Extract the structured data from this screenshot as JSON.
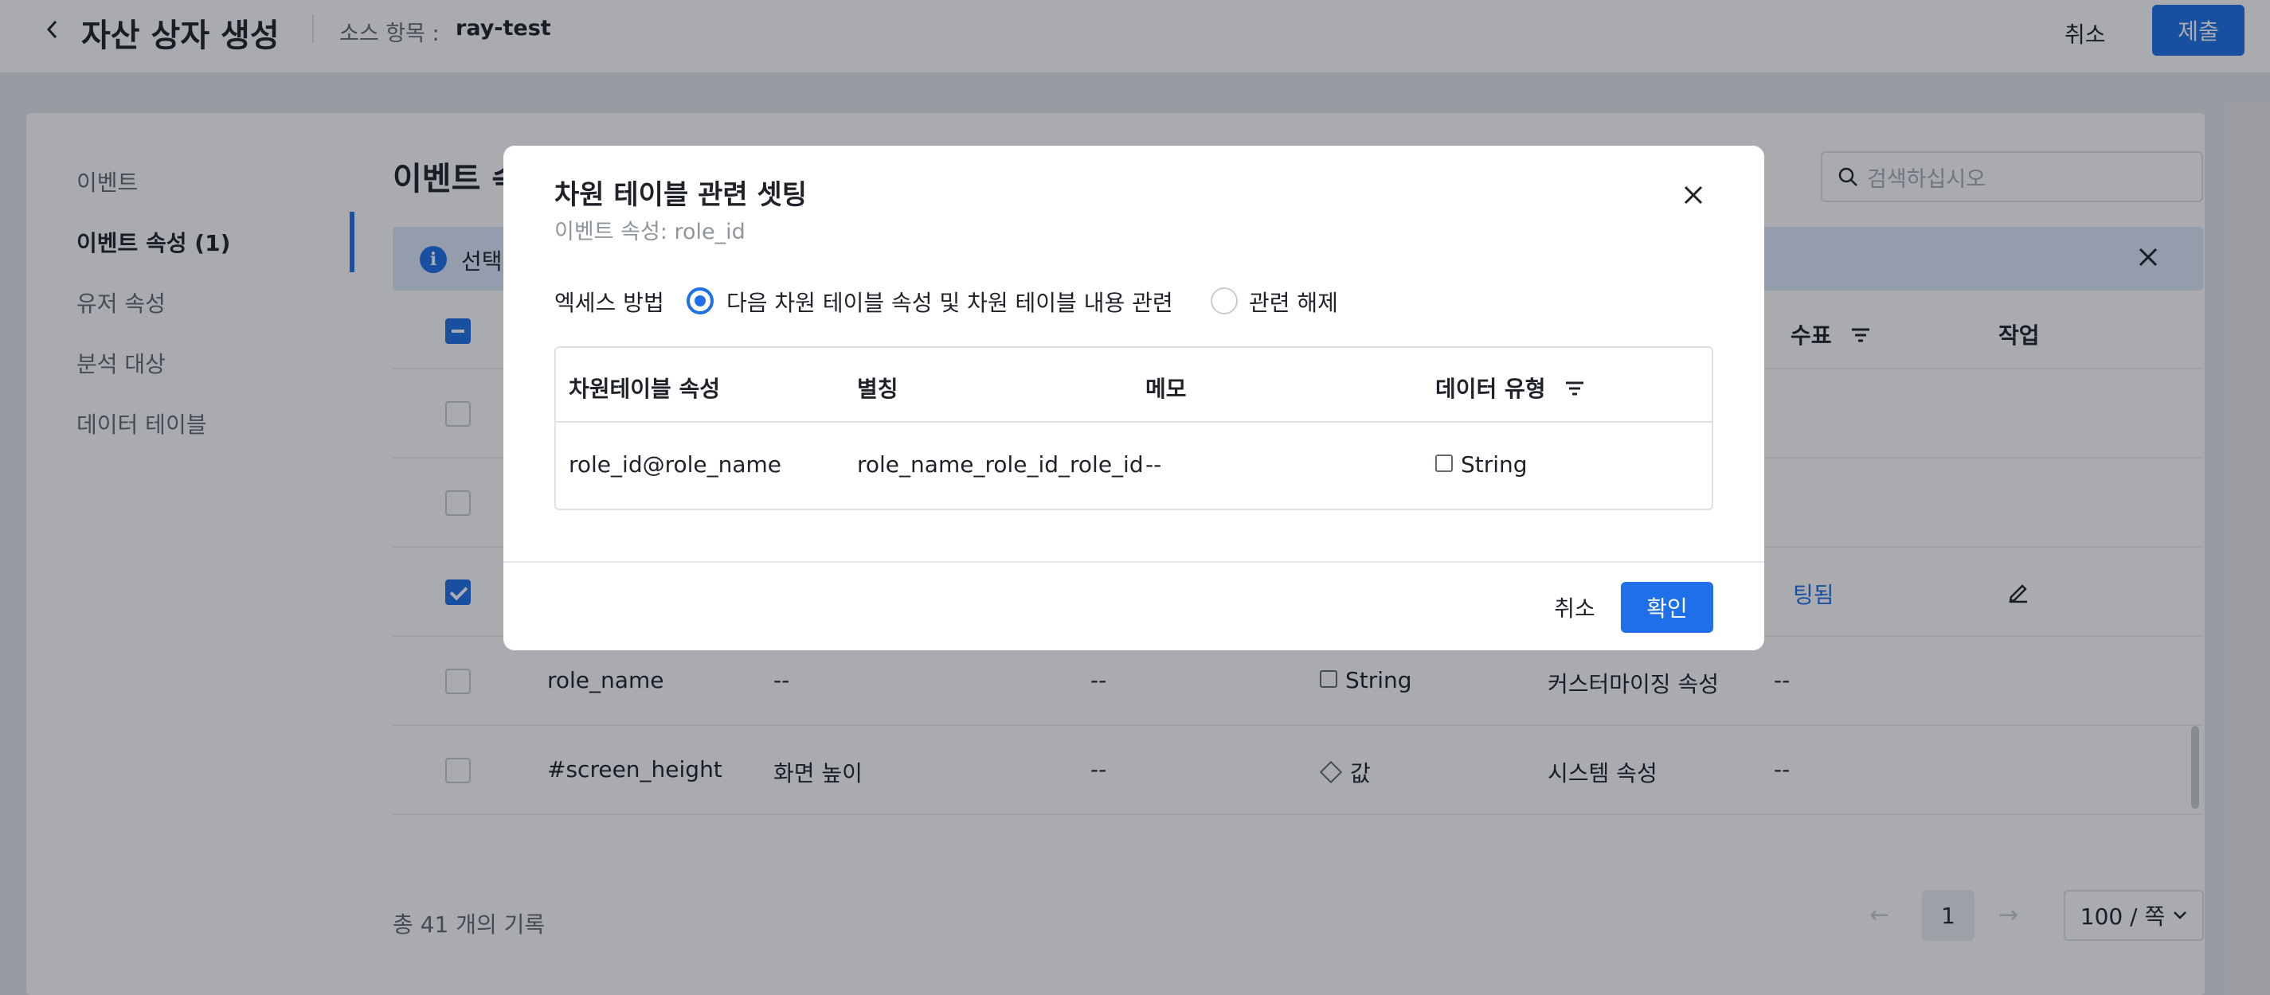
{
  "header": {
    "back_icon": "chevron-left-icon",
    "title": "자산 상자 생성",
    "source_label": "소스 항목 :",
    "source_value": "ray-test",
    "cancel_label": "취소",
    "submit_label": "제출"
  },
  "sidebar": {
    "items": [
      {
        "label": "이벤트"
      },
      {
        "label": "이벤트 속성 (1)",
        "active": true
      },
      {
        "label": "유저 속성"
      },
      {
        "label": "분석 대상"
      },
      {
        "label": "데이터 테이블"
      }
    ]
  },
  "main": {
    "section_title": "이벤트 속성",
    "search_placeholder": "검색하십시오",
    "info_text": "선택",
    "columns": {
      "partial_header": "수표",
      "action": "작업"
    },
    "rows": [
      {
        "checked": true,
        "partial_status": "팅됨",
        "action_icon": "edit-icon"
      },
      {
        "checked": false,
        "name": "role_name",
        "alias": "--",
        "memo": "--",
        "type": "String",
        "category": "커스터마이징 속성",
        "extra": "--"
      },
      {
        "checked": false,
        "name": "#screen_height",
        "alias": "화면 높이",
        "memo": "--",
        "type": "값",
        "category": "시스템 속성",
        "extra": "--"
      }
    ],
    "total_text": "총 41 개의 기록",
    "pagination": {
      "current_page": "1",
      "page_size": "100 / 쪽"
    }
  },
  "modal": {
    "title": "차원 테이블 관련 셋팅",
    "subtitle": "이벤트 속성: role_id",
    "access_label": "엑세스 방법",
    "options": [
      {
        "label": "다음 차원 테이블 속성 및 차원 테이블 내용 관련",
        "selected": true
      },
      {
        "label": "관련 해제",
        "selected": false
      }
    ],
    "table": {
      "headers": [
        "차원테이블 속성",
        "별칭",
        "메모",
        "데이터 유형"
      ],
      "row": {
        "attribute": "role_id@role_name",
        "alias": "role_name_role_id_role_id",
        "memo": "--",
        "type": "String"
      }
    },
    "cancel_label": "취소",
    "confirm_label": "확인"
  },
  "colors": {
    "primary": "#1e6fe8",
    "info_bg": "#dfe9fb",
    "overlay": "rgba(18,22,33,0.36)"
  }
}
